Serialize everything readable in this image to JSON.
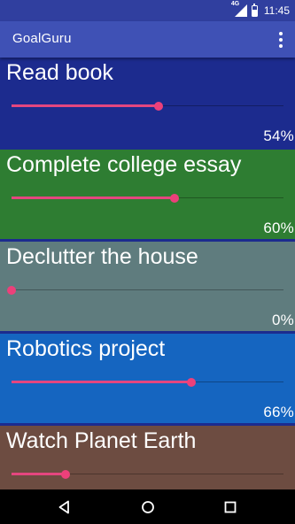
{
  "status_bar": {
    "network_label": "4G",
    "time": "11:45"
  },
  "app_bar": {
    "title": "GoalGuru"
  },
  "goals": [
    {
      "title": "Read book",
      "progress": 54,
      "percent_label": "54%",
      "color": "#1c2b8e"
    },
    {
      "title": "Complete college essay",
      "progress": 60,
      "percent_label": "60%",
      "color": "#2e7d32"
    },
    {
      "title": "Declutter the house",
      "progress": 0,
      "percent_label": "0%",
      "color": "#5f7c7e"
    },
    {
      "title": "Robotics project",
      "progress": 66,
      "percent_label": "66%",
      "color": "#1565c0"
    },
    {
      "title": "Watch Planet Earth",
      "progress": 20,
      "percent_label": "",
      "color": "#6d4c41"
    }
  ],
  "nav_bar": {
    "back_icon": "back-icon",
    "home_icon": "home-icon",
    "recents_icon": "recents-icon"
  },
  "colors": {
    "app_bar": "#3f51b5",
    "status_bar": "#303f9f",
    "accent": "#ec407a"
  }
}
